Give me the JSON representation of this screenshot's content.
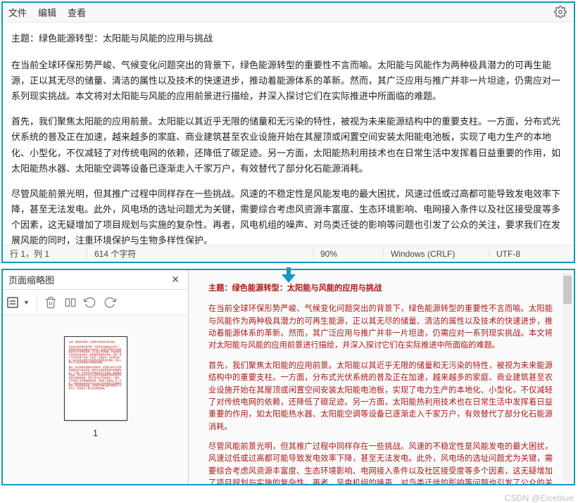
{
  "menu": {
    "file": "文件",
    "edit": "编辑",
    "view": "查看"
  },
  "gear": "settings",
  "document": {
    "title_line": "主题：绿色能源转型：太阳能与风能的应用与挑战",
    "para1": "在当前全球环保形势严峻、气候变化问题突出的背景下，绿色能源转型的重要性不言而喻。太阳能与风能作为两种极具潜力的可再生能源，正以其无尽的储量、清洁的属性以及技术的快速进步，推动着能源体系的革新。然而，其广泛应用与推广并非一片坦途，仍需应对一系列现实挑战。本文将对太阳能与风能的应用前景进行描绘，并深入探讨它们在实际推进中所面临的难题。",
    "para2": "首先，我们聚焦太阳能的应用前景。太阳能以其近乎无限的储量和无污染的特性，被视为未来能源结构中的重要支柱。一方面，分布式光伏系统的普及正在加速，越来越多的家庭、商业建筑甚至农业设施开始在其屋顶或闲置空间安装太阳能电池板，实现了电力生产的本地化、小型化，不仅减轻了对传统电网的依赖，还降低了碳足迹。另一方面，太阳能热利用技术也在日常生活中发挥着日益重要的作用，如太阳能热水器、太阳能空调等设备已逐渐走入千家万户，有效替代了部分化石能源消耗。",
    "para3": "尽管风能前景光明，但其推广过程中同样存在一些挑战。风速的不稳定性是风能发电的最大困扰，风速过低或过高都可能导致发电效率下降，甚至无法发电。此外，风电场的选址问题尤为关键，需要综合考虑风资源丰富度、生态环境影响、电网接入条件以及社区接受度等多个因素，这无疑增加了项目规划与实施的复杂性。再者，风电机组的噪声、对鸟类迁徙的影响等问题也引发了公众的关注，要求我们在发展风能的同时，注重环境保护与生物多样性保护。"
  },
  "status": {
    "lncol": "行 1，列 1",
    "chars": "614 个字符",
    "zoom": "90%",
    "crlf": "Windows (CRLF)",
    "encoding": "UTF-8"
  },
  "thumbnail_sidebar": {
    "title": "页面缩略图",
    "page_num": "1"
  },
  "preview": {
    "pv_title": "主题：绿色能源转型：太阳能与风能的应用与挑战",
    "pv_para1": "在当前全球环保形势严峻、气候变化问题突出的背景下，绿色能源转型的重要性不言而喻。太阳能与风能作为两种极具潜力的可再生能源，正以其无尽的储量、清洁的属性以及技术的快速进步，推动着能源体系的革新。然而，其广泛应用与推广并非一片坦途，仍需应对一系列现实挑战。本文将对太阳能与风能的应用前景进行描绘，并深入探讨它们在实际推进中所面临的难题。",
    "pv_para2": "首先，我们聚焦太阳能的应用前景。太阳能以其近乎无限的储量和无污染的特性，被视为未来能源结构中的重要支柱。一方面，分布式光伏系统的普及正在加速，越来越多的家庭、商业建筑甚至农业设施开始在其屋顶或闲置空间安装太阳能电池板，实现了电力生产的本地化、小型化，不仅减轻了对传统电网的依赖，还降低了碳足迹。另一方面，太阳能热利用技术也在日常生活中发挥着日益重要的作用，如太阳能热水器、太阳能空调等设备已逐渐走入千家万户，有效替代了部分化石能源消耗。",
    "pv_para3": "尽管风能前景光明，但其推广过程中同样存在一些挑战。风速的不稳定性是风能发电的最大困扰，风速过低或过高都可能导致发电效率下降，甚至无法发电。此外，风电场的选址问题尤为关键，需要综合考虑风资源丰富度、生态环境影响、电网接入条件以及社区接受度等多个因素，这无疑增加了项目规划与实施的复杂性。再者，风电机组的噪声、对鸟类迁徙的影响等问题也引发了公众的关注，要求我们在发展风能的同时，注重环境保护与生物多样性保护。"
  },
  "watermark": "CSDN @Eiceblue"
}
